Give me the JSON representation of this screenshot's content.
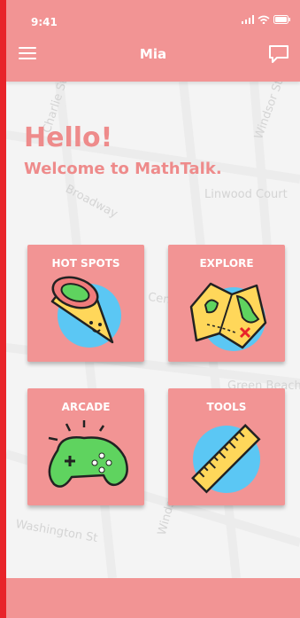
{
  "status": {
    "time": "9:41"
  },
  "header": {
    "title": "Mia"
  },
  "greeting": {
    "hello": "Hello!",
    "welcome": "Welcome to MathTalk."
  },
  "cards": [
    {
      "label": "HOT SPOTS",
      "icon": "pizza-slice-icon"
    },
    {
      "label": "EXPLORE",
      "icon": "treasure-map-icon"
    },
    {
      "label": "ARCADE",
      "icon": "gamepad-icon"
    },
    {
      "label": "TOOLS",
      "icon": "ruler-icon"
    }
  ],
  "map_labels": {
    "broadway": "Broadway",
    "linwood": "Linwood Court",
    "windsor_top": "Windsor St",
    "windsor_bottom": "Windsor St",
    "washington": "Washington St",
    "center": "Center St",
    "green": "Green Beach",
    "charlie": "Charlie St"
  },
  "colors": {
    "frame": "#e8242a",
    "header": "#f29494",
    "accent_text": "#ee8b8b",
    "icon_circle": "#5bc7f4"
  }
}
